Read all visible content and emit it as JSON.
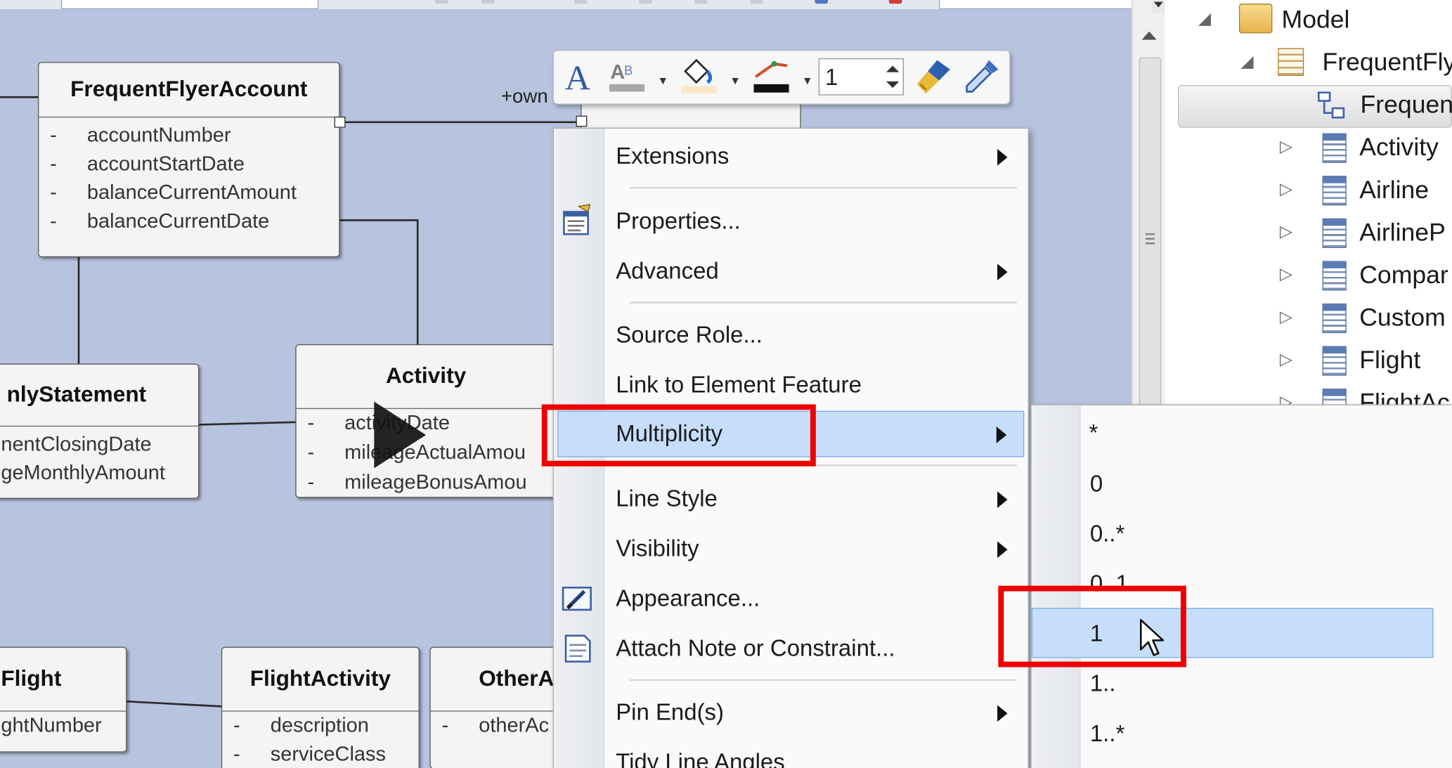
{
  "diagram": {
    "classes": [
      {
        "name": "FrequentFlyerAccount",
        "attributes": [
          {
            "vis": "-",
            "name": "accountNumber"
          },
          {
            "vis": "-",
            "name": "accountStartDate"
          },
          {
            "vis": "-",
            "name": "balanceCurrentAmount"
          },
          {
            "vis": "-",
            "name": "balanceCurrentDate"
          }
        ]
      },
      {
        "name": "nlyStatement",
        "attributes": [
          {
            "vis": "",
            "name": "nentClosingDate"
          },
          {
            "vis": "",
            "name": "geMonthlyAmount"
          }
        ]
      },
      {
        "name": "Activity",
        "attributes": [
          {
            "vis": "-",
            "name": "activityDate"
          },
          {
            "vis": "-",
            "name": "mileageActualAmou"
          },
          {
            "vis": "-",
            "name": "mileageBonusAmou"
          }
        ]
      },
      {
        "name": "Flight",
        "attributes": [
          {
            "vis": "",
            "name": "ghtNumber"
          }
        ]
      },
      {
        "name": "FlightActivity",
        "attributes": [
          {
            "vis": "-",
            "name": "description"
          },
          {
            "vis": "-",
            "name": "serviceClass"
          }
        ]
      },
      {
        "name": "OtherA",
        "attributes": [
          {
            "vis": "-",
            "name": "otherAc"
          }
        ]
      }
    ],
    "role_label": "+own"
  },
  "mini_toolbar": {
    "line_width": "1",
    "icons": [
      "font-icon",
      "font-color-icon",
      "fill-color-icon",
      "line-color-icon",
      "format-painter-icon",
      "eyedropper-icon"
    ]
  },
  "context_menu": {
    "items": [
      {
        "label": "Extensions",
        "submenu": true
      },
      {
        "label": "Properties...",
        "icon": "properties-icon"
      },
      {
        "label": "Advanced",
        "submenu": true
      },
      {
        "label": "Source Role..."
      },
      {
        "label": "Link to Element Feature"
      },
      {
        "label": "Multiplicity",
        "submenu": true,
        "highlighted": true
      },
      {
        "label": "Line Style",
        "submenu": true
      },
      {
        "label": "Visibility",
        "submenu": true
      },
      {
        "label": "Appearance...",
        "icon": "appearance-icon"
      },
      {
        "label": "Attach Note or Constraint...",
        "icon": "note-icon"
      },
      {
        "label": "Pin End(s)",
        "submenu": true
      },
      {
        "label": "Tidy Line Angles"
      }
    ]
  },
  "multiplicity_submenu": {
    "options": [
      "*",
      "0",
      "0..*",
      "0..1",
      "1",
      "1..",
      "1..*"
    ],
    "selected": "1"
  },
  "project_tree": {
    "items": [
      {
        "label": "Model",
        "expander": "◢"
      },
      {
        "label": "FrequentFly",
        "expander": "◢"
      },
      {
        "label": "Frequen",
        "selected": true
      },
      {
        "label": "Activity",
        "expander": "▷"
      },
      {
        "label": "Airline",
        "expander": "▷"
      },
      {
        "label": "AirlineP",
        "expander": "▷"
      },
      {
        "label": "Compar",
        "expander": "▷"
      },
      {
        "label": "Custom",
        "expander": "▷"
      },
      {
        "label": "Flight",
        "expander": "▷"
      },
      {
        "label": "FlightAc",
        "expander": "▷"
      }
    ],
    "occluded_fragments": [
      "en",
      "ly",
      "Ac"
    ]
  },
  "colors": {
    "canvas": "#b7c3df",
    "highlight": "#c6defa",
    "annotation": "#ee0000"
  }
}
